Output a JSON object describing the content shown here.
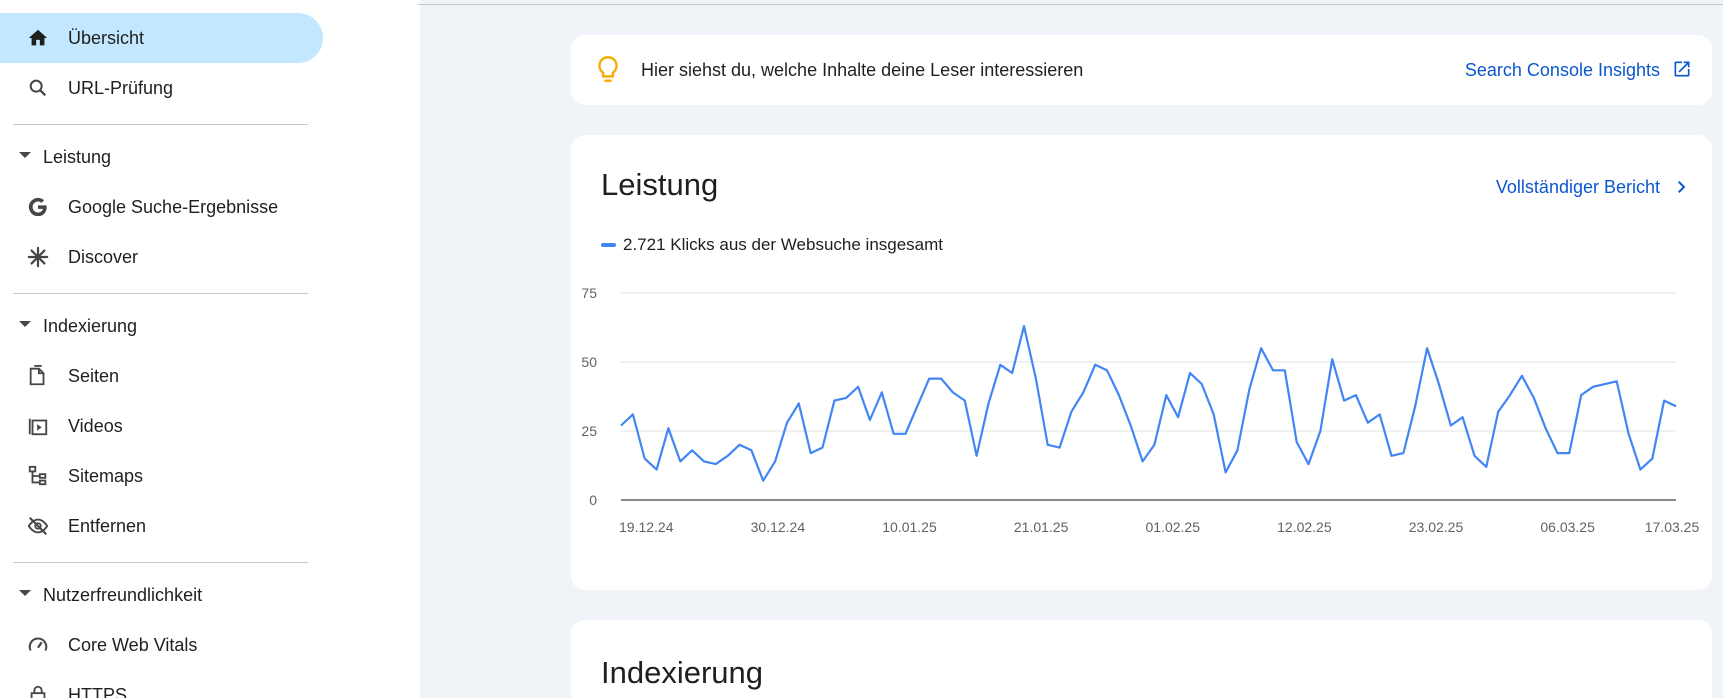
{
  "sidebar": {
    "overview": "Übersicht",
    "url_inspection": "URL-Prüfung",
    "performance_section": "Leistung",
    "google_search": "Google Suche-Ergebnisse",
    "discover": "Discover",
    "indexing_section": "Indexierung",
    "pages": "Seiten",
    "videos": "Videos",
    "sitemaps": "Sitemaps",
    "removals": "Entfernen",
    "experience_section": "Nutzerfreundlichkeit",
    "core_web_vitals": "Core Web Vitals",
    "https": "HTTPS"
  },
  "insight": {
    "text": "Hier siehst du, welche Inhalte deine Leser interessieren",
    "link": "Search Console Insights"
  },
  "performance": {
    "title": "Leistung",
    "full_report": "Vollständiger Bericht",
    "legend": "2.721 Klicks aus der Websuche insgesamt"
  },
  "indexing": {
    "title": "Indexierung"
  },
  "colors": {
    "accent": "#0b57d0",
    "series": "#4285f4",
    "active_nav": "#c2e7ff",
    "bulb": "#f9ab00"
  },
  "chart_data": {
    "type": "line",
    "title": "",
    "xlabel": "",
    "ylabel": "",
    "ylim": [
      0,
      75
    ],
    "yticks": [
      0,
      25,
      50,
      75
    ],
    "x_tick_labels": [
      "19.12.24",
      "30.12.24",
      "10.01.25",
      "21.01.25",
      "01.02.25",
      "12.02.25",
      "23.02.25",
      "06.03.25",
      "17.03.25"
    ],
    "x_start": "19.12.24",
    "x_end": "17.03.25",
    "series": [
      {
        "name": "2.721 Klicks aus der Websuche insgesamt",
        "values": [
          27,
          31,
          15,
          11,
          26,
          14,
          18,
          14,
          13,
          16,
          20,
          18,
          7,
          14,
          28,
          35,
          17,
          19,
          36,
          37,
          41,
          29,
          39,
          24,
          24,
          34,
          44,
          44,
          39,
          36,
          16,
          35,
          49,
          46,
          63,
          44,
          20,
          19,
          32,
          39,
          49,
          47,
          38,
          27,
          14,
          20,
          38,
          30,
          46,
          42,
          31,
          10,
          18,
          40,
          55,
          47,
          47,
          21,
          13,
          25,
          51,
          36,
          38,
          28,
          31,
          16,
          17,
          34,
          55,
          42,
          27,
          30,
          16,
          12,
          32,
          38,
          45,
          37,
          26,
          17,
          17,
          38,
          41,
          42,
          43,
          24,
          11,
          15,
          36,
          34
        ]
      }
    ],
    "grid": true,
    "legend_position": "top-left"
  }
}
